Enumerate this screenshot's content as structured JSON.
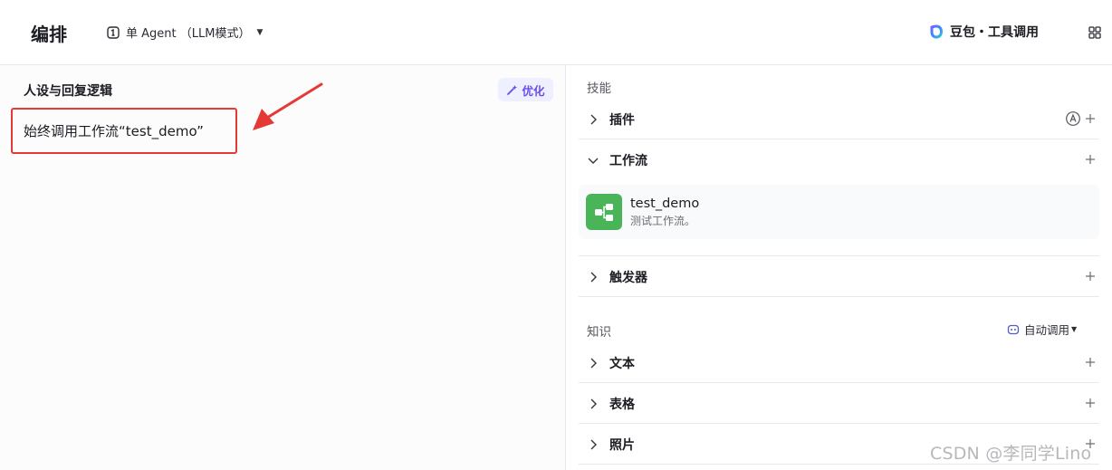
{
  "header": {
    "title": "编排",
    "mode_label": "单 Agent （LLM模式）",
    "model_label": "豆包・工具调用"
  },
  "prompt_panel": {
    "title": "人设与回复逻辑",
    "optimize_label": "优化",
    "prompt_text": "始终调用工作流“test_demo”"
  },
  "skills": {
    "section_label": "技能",
    "plugins_label": "插件",
    "workflow_label": "工作流",
    "workflow_item": {
      "name": "test_demo",
      "description": "测试工作流。"
    },
    "trigger_label": "触发器"
  },
  "knowledge": {
    "section_label": "知识",
    "auto_call_label": "自动调用",
    "text_label": "文本",
    "table_label": "表格",
    "photo_label": "照片"
  },
  "watermark": "CSDN @李同学Lino",
  "colors": {
    "accent_purple": "#6b4ee6",
    "workflow_green": "#4ab458",
    "highlight_red": "#e53935"
  }
}
